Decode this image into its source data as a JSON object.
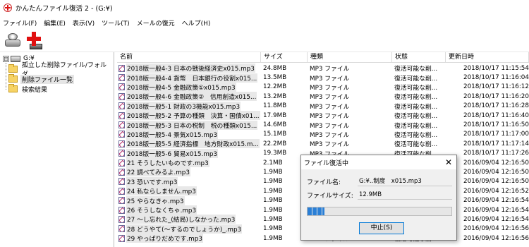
{
  "window": {
    "title": "かんたんファイル復活 2 - (G:¥)"
  },
  "menu": [
    "ファイル(F)",
    "編集(E)",
    "表示(V)",
    "ツール(T)",
    "メールの復元",
    "ヘルプ(H)"
  ],
  "toolbar": {
    "buttons": [
      "drive-icon",
      "recover-icon"
    ]
  },
  "tree": {
    "root": "G:¥",
    "expander": "⊟",
    "children": [
      "孤立した削除ファイル/フォルダ",
      "削除ファイル一覧",
      "検索結果"
    ],
    "selected_index": 1
  },
  "list": {
    "columns": [
      "名前",
      "サイズ",
      "種類",
      "状態",
      "更新日時"
    ],
    "rows": [
      {
        "name": "2018版一般4-3 日本の戦後経済史x015.mp3",
        "size": "24.8MB",
        "type": "MP3 ファイル",
        "state": "復活可能な削...",
        "time": "2018/10/17 11:15:54"
      },
      {
        "name": "2018版一般4-4 貨幣　日本銀行の役割x015...",
        "size": "13.5MB",
        "type": "MP3 ファイル",
        "state": "復活可能な削...",
        "time": "2018/10/17 11:16:04"
      },
      {
        "name": "2018版一般4-5 金融政策①x015.mp3",
        "size": "12.2MB",
        "type": "MP3 ファイル",
        "state": "復活可能な削...",
        "time": "2018/10/17 11:16:12"
      },
      {
        "name": "2018版一般4-6 金融政策②　信用創造x015...",
        "size": "13.2MB",
        "type": "MP3 ファイル",
        "state": "復活可能な削...",
        "time": "2018/10/17 11:16:20"
      },
      {
        "name": "2018版一般5-1 財政の3機能x015.mp3",
        "size": "11.8MB",
        "type": "MP3 ファイル",
        "state": "復活可能な削...",
        "time": "2018/10/17 11:16:28"
      },
      {
        "name": "2018版一般5-2 予算の種類　決算・国債x01...",
        "size": "17.9MB",
        "type": "MP3 ファイル",
        "state": "復活可能な削...",
        "time": "2018/10/17 11:16:40"
      },
      {
        "name": "2018版一般5-3 日本の税制　税の種類x015...",
        "size": "14.6MB",
        "type": "MP3 ファイル",
        "state": "復活可能な削...",
        "time": "2018/10/17 11:16:50"
      },
      {
        "name": "2018版一般5-4 景気x015.mp3",
        "size": "15.1MB",
        "type": "MP3 ファイル",
        "state": "復活可能な削...",
        "time": "2018/10/17 11:17:00"
      },
      {
        "name": "2018版一般5-5 経済指標　地方財政x015.m...",
        "size": "22.2MB",
        "type": "MP3 ファイル",
        "state": "復活可能な削...",
        "time": "2018/10/17 11:17:14"
      },
      {
        "name": "2018版一般5-6 貿易x015.mp3",
        "size": "19.3MB",
        "type": "MP3 ファイル",
        "state": "復活可能な削...",
        "time": "2018/10/17 11:17:26"
      },
      {
        "name": "21 そうしたいものです.mp3",
        "size": "2.1MB",
        "type": "MP3 ファイル",
        "state": "復活可能な削...",
        "time": "2016/09/04 12:16:50"
      },
      {
        "name": "22 調べてみるよ.mp3",
        "size": "1.9MB",
        "type": "MP3 ファイル",
        "state": "復活可能な削...",
        "time": "2016/09/04 12:16:50"
      },
      {
        "name": "23 恐いです.mp3",
        "size": "1.9MB",
        "type": "MP3 ファイル",
        "state": "復活可能な削...",
        "time": "2016/09/04 12:16:50"
      },
      {
        "name": "24 私ならしません.mp3",
        "size": "1.9MB",
        "type": "MP3 ファイル",
        "state": "復活可能な削...",
        "time": "2016/09/04 12:16:52"
      },
      {
        "name": "25 やらなきゃ.mp3",
        "size": "1.9MB",
        "type": "MP3 ファイル",
        "state": "復活可能な削...",
        "time": "2016/09/04 12:16:54"
      },
      {
        "name": "26 そうしなくちゃ.mp3",
        "size": "1.9MB",
        "type": "MP3 ファイル",
        "state": "復活可能な削...",
        "time": "2016/09/04 12:16:54"
      },
      {
        "name": "27 ～し忘れた_(結局)しなかった.mp3",
        "size": "1.9MB",
        "type": "MP3 ファイル",
        "state": "復活可能な削...",
        "time": "2016/09/04 12:16:54"
      },
      {
        "name": "28 どうやて(～するのでしょうか)_.mp3",
        "size": "1.9MB",
        "type": "MP3 ファイル",
        "state": "復活可能な削...",
        "time": "2016/09/04 12:16:56"
      },
      {
        "name": "29 やっぱりだめです.mp3",
        "size": "1.9MB",
        "type": "MP3 ファイル",
        "state": "復活可能な削...",
        "time": "2016/09/04 12:16:56"
      }
    ]
  },
  "dialog": {
    "title": "ファイル復活中",
    "close_glyph": "✕",
    "filename_label": "ファイル名:",
    "filename_value": "G:¥..制度　x015.mp3",
    "filesize_label": "ファイルサイズ:",
    "filesize_value": "12.9MB",
    "progress_fraction": 0.12,
    "stop_label": "中止(S)"
  },
  "colors": {
    "accent": "#0078d7",
    "progress": "#2a7fd6",
    "selection": "#e5e5e5",
    "brand_red": "#e01010"
  }
}
